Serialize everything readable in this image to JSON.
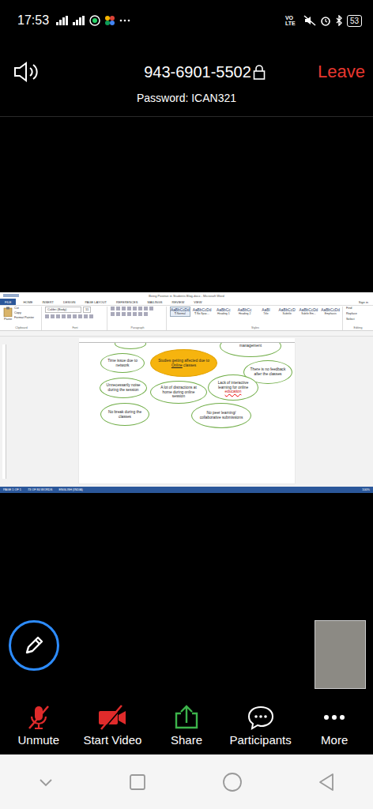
{
  "phone_status": {
    "time": "17:53",
    "volte": "VO LTE",
    "battery": "53"
  },
  "meeting": {
    "id": "943-6901-5502",
    "password": "Password: ICAN321",
    "leave": "Leave"
  },
  "word": {
    "title": "Being Positive in Students Blog.docx - Microsoft Word",
    "account": "Sign in",
    "tabs": [
      {
        "label": "FILE",
        "selected": true
      },
      {
        "label": "HOME",
        "selected": false
      },
      {
        "label": "INSERT",
        "selected": false
      },
      {
        "label": "DESIGN",
        "selected": false
      },
      {
        "label": "PAGE LAYOUT",
        "selected": false
      },
      {
        "label": "REFERENCES",
        "selected": false
      },
      {
        "label": "MAILINGS",
        "selected": false
      },
      {
        "label": "REVIEW",
        "selected": false
      },
      {
        "label": "VIEW",
        "selected": false
      }
    ],
    "paste": "Paste",
    "clipboard_items": [
      "Cut",
      "Copy",
      "Format Painter"
    ],
    "font": {
      "name": "Calibri (Body)",
      "size": "11"
    },
    "styles": [
      {
        "preview": "AaBbCcDd",
        "name": "¶ Normal",
        "selected": true
      },
      {
        "preview": "AaBbCcDd",
        "name": "¶ No Spac...",
        "selected": false
      },
      {
        "preview": "AaBbCc",
        "name": "Heading 1",
        "selected": false
      },
      {
        "preview": "AaBbCc",
        "name": "Heading 2",
        "selected": false
      },
      {
        "preview": "AaBl",
        "name": "Title",
        "selected": false
      },
      {
        "preview": "AaBbCcD",
        "name": "Subtitle",
        "selected": false
      },
      {
        "preview": "AaBbCcDd",
        "name": "Subtle Em...",
        "selected": false
      },
      {
        "preview": "AaBbCcDd",
        "name": "Emphasis",
        "selected": false
      }
    ],
    "editing": [
      "Find",
      "Replace",
      "Select"
    ],
    "groups": [
      "Clipboard",
      "Font",
      "Paragraph",
      "Styles",
      "Editing"
    ],
    "diagram": {
      "nodes": [
        {
          "kind": "branch",
          "segments": []
        },
        {
          "kind": "branch",
          "segments": [
            {
              "text": "management",
              "mark": "plain"
            }
          ]
        },
        {
          "kind": "center",
          "segments": [
            {
              "text": "Studies getting affected due to ",
              "mark": "plain"
            },
            {
              "text": "Online",
              "mark": "underline"
            },
            {
              "text": " classes",
              "mark": "plain"
            }
          ]
        },
        {
          "kind": "branch",
          "segments": [
            {
              "text": "Time issue due to network",
              "mark": "plain"
            }
          ]
        },
        {
          "kind": "branch",
          "segments": [
            {
              "text": "There is no feedback after the classes",
              "mark": "plain"
            }
          ]
        },
        {
          "kind": "branch",
          "segments": [
            {
              "text": "Unnecessarily noise during the session",
              "mark": "plain"
            }
          ]
        },
        {
          "kind": "branch",
          "segments": [
            {
              "text": "Lack of interactive learning for online ",
              "mark": "plain"
            },
            {
              "text": "education",
              "mark": "error"
            }
          ]
        },
        {
          "kind": "branch",
          "segments": [
            {
              "text": "A lot of distractions at home during online session",
              "mark": "plain"
            }
          ]
        },
        {
          "kind": "branch",
          "segments": [
            {
              "text": "No break during the classes",
              "mark": "plain"
            }
          ]
        },
        {
          "kind": "branch",
          "segments": [
            {
              "text": "No peer learning/ collaborative submissions",
              "mark": "plain"
            }
          ]
        }
      ]
    },
    "status": [
      "PAGE 1 OF 1",
      "73 OF 80 WORDS",
      "ENGLISH (INDIA)"
    ],
    "zoom": "100%"
  },
  "toolbar": [
    {
      "label": "Unmute",
      "kind": "mic",
      "off": true
    },
    {
      "label": "Start Video",
      "kind": "video",
      "off": true
    },
    {
      "label": "Share",
      "kind": "share",
      "off": false
    },
    {
      "label": "Participants",
      "kind": "participants",
      "off": false
    },
    {
      "label": "More",
      "kind": "more",
      "off": false
    }
  ]
}
